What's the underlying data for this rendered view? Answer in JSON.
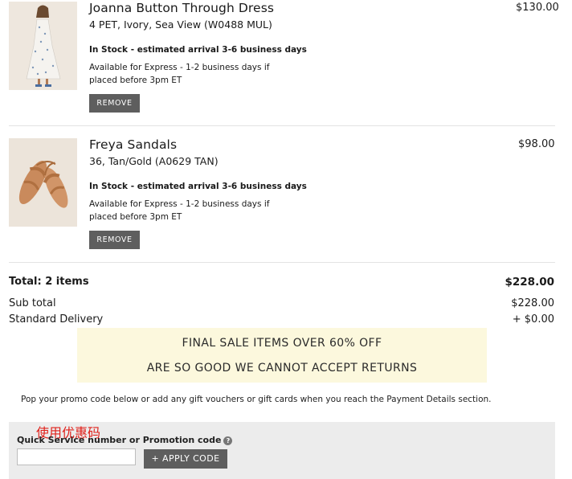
{
  "cart": {
    "items": [
      {
        "name": "Joanna Button Through Dress",
        "variant": "4 PET, Ivory, Sea View (W0488 MUL)",
        "stock": "In Stock - estimated arrival 3-6 business days",
        "express": "Available for Express - 1-2 business days if placed before 3pm ET",
        "price": "$130.00",
        "remove_label": "REMOVE",
        "image_icon": "dress-photo"
      },
      {
        "name": "Freya Sandals",
        "variant": "36, Tan/Gold (A0629 TAN)",
        "stock": "In Stock - estimated arrival 3-6 business days",
        "express": "Available for Express - 1-2 business days if placed before 3pm ET",
        "price": "$98.00",
        "remove_label": "REMOVE",
        "image_icon": "sandals-photo"
      }
    ]
  },
  "summary": {
    "total_label": "Total: 2 items",
    "total_value": "$228.00",
    "subtotal_label": "Sub total",
    "subtotal_value": "$228.00",
    "delivery_label": "Standard Delivery",
    "delivery_value": "+ $0.00"
  },
  "banner": {
    "line1": "FINAL SALE ITEMS OVER 60% OFF",
    "line2": "ARE SO GOOD WE CANNOT ACCEPT RETURNS"
  },
  "promo": {
    "note": "Pop your promo code below or add any gift vouchers or gift cards when you reach the Payment Details section.",
    "annotation": "使用优惠码",
    "label": "Quick Service number or Promotion code",
    "help_icon": "?",
    "input_value": "",
    "input_placeholder": "",
    "apply_label": "+ APPLY CODE"
  },
  "colors": {
    "button_bg": "#5e5e5e",
    "banner_bg": "#fcf8dd",
    "promo_bg": "#ececec",
    "annotation": "#e0201a"
  }
}
